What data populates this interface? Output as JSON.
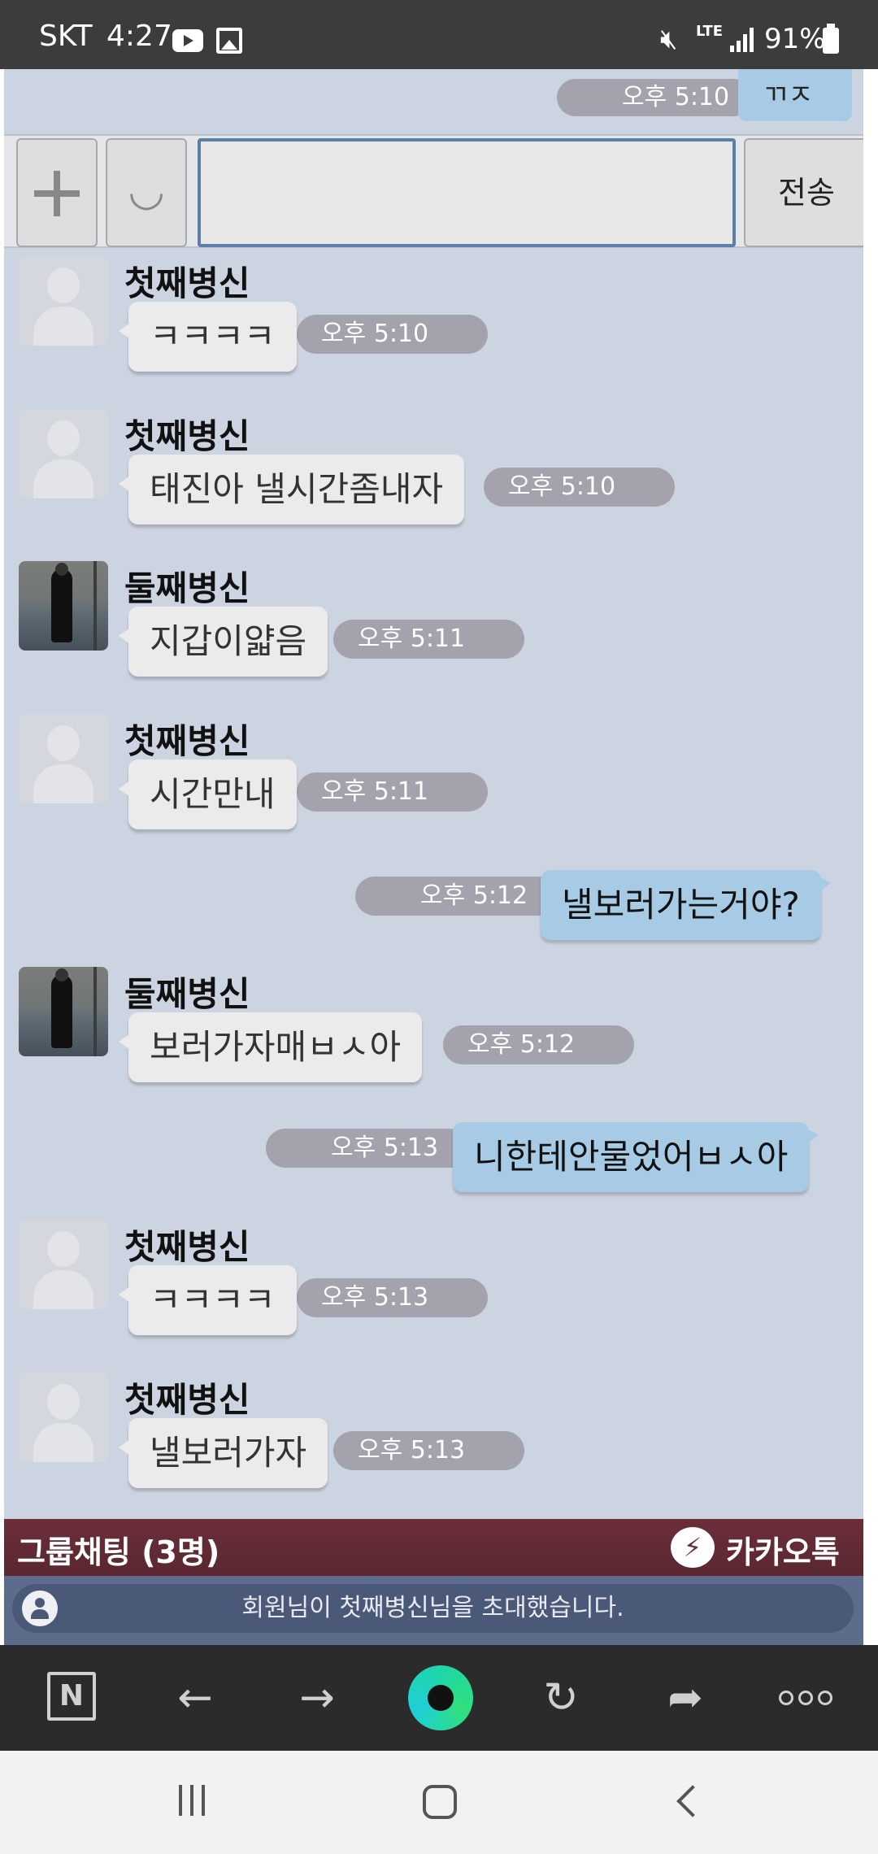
{
  "status_bar": {
    "carrier": "SKT",
    "time": "4:27",
    "network": "LTE",
    "battery": "91%",
    "icons": [
      "youtube-icon",
      "gallery-icon",
      "mute-icon",
      "lte-icon",
      "signal-icon",
      "battery-icon"
    ]
  },
  "chat": {
    "top_message": {
      "text": "ㄲㅈ",
      "time": "오후 5:10"
    },
    "input": {
      "value": "",
      "send_label": "전송"
    },
    "messages": [
      {
        "type": "received",
        "sender": "첫째병신",
        "text": "ㅋㅋㅋㅋ",
        "time": "오후 5:10",
        "avatar": "default"
      },
      {
        "type": "received",
        "sender": "첫째병신",
        "text": "태진아 낼시간좀내자",
        "time": "오후 5:10",
        "avatar": "default"
      },
      {
        "type": "received",
        "sender": "둘째병신",
        "text": "지갑이얇음",
        "time": "오후 5:11",
        "avatar": "photo"
      },
      {
        "type": "received",
        "sender": "첫째병신",
        "text": "시간만내",
        "time": "오후 5:11",
        "avatar": "default"
      },
      {
        "type": "sent",
        "text": "낼보러가는거야?",
        "time": "오후 5:12"
      },
      {
        "type": "received",
        "sender": "둘째병신",
        "text": "보러가자매ㅂㅅ아",
        "time": "오후 5:12",
        "avatar": "photo"
      },
      {
        "type": "sent",
        "text": "니한테안물었어ㅂㅅ아",
        "time": "오후 5:13"
      },
      {
        "type": "received",
        "sender": "첫째병신",
        "text": "ㅋㅋㅋㅋ",
        "time": "오후 5:13",
        "avatar": "default"
      },
      {
        "type": "received",
        "sender": "첫째병신",
        "text": "낼보러가자",
        "time": "오후 5:13",
        "avatar": "default"
      }
    ],
    "group_title": "그룹채팅 (3명)",
    "app_name": "카카오톡",
    "notice": "회원님이 첫째병신님을 초대했습니다.",
    "colors": {
      "background": "#ccd4e1",
      "sent_bubble": "#a8cbe5",
      "received_bubble": "#ebebeb",
      "time_pill": "#a3a2ad",
      "group_bar": "#6b2e3a"
    }
  },
  "browser_toolbar": {
    "items": [
      "naver-n-icon",
      "back-arrow-icon",
      "forward-arrow-icon",
      "green-circle-icon",
      "refresh-icon",
      "share-icon",
      "more-icon"
    ]
  },
  "nav_bar": {
    "items": [
      "recent-apps-icon",
      "home-icon",
      "back-icon"
    ]
  }
}
